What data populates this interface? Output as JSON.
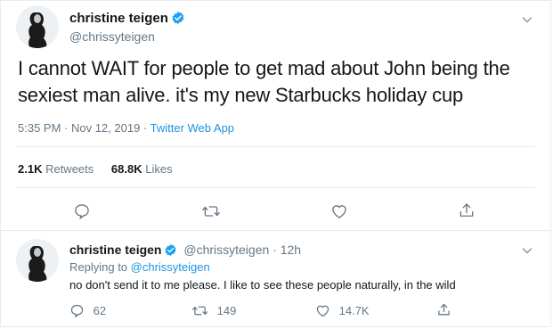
{
  "tweet": {
    "display_name": "christine teigen",
    "handle": "@chrissyteigen",
    "text_line1": "I cannot WAIT for people to get mad about John being the",
    "text_line2": "sexiest man alive. it's my new Starbucks holiday cup",
    "timestamp": "5:35 PM · Nov 12, 2019 · ",
    "source": "Twitter Web App",
    "retweets_count": "2.1K",
    "retweets_label": " Retweets",
    "likes_count": "68.8K",
    "likes_label": " Likes"
  },
  "reply": {
    "display_name": "christine teigen",
    "handle_time": "@chrissyteigen · 12h",
    "replying_label": "Replying to ",
    "replying_handle": "@chrissyteigen",
    "text": "no don't send it to me please. I like to see these people naturally, in the wild",
    "reply_count": "62",
    "retweet_count": "149",
    "like_count": "14.7K"
  },
  "icons": {
    "more": "chevron-down-icon",
    "reply": "comment-icon",
    "retweet": "retweet-icon",
    "like": "heart-icon",
    "share": "share-icon",
    "verified": "verified-badge-icon"
  },
  "colors": {
    "link": "#1b95e0",
    "muted": "#657786",
    "divider": "#e6ecf0",
    "verified": "#1da1f2"
  }
}
